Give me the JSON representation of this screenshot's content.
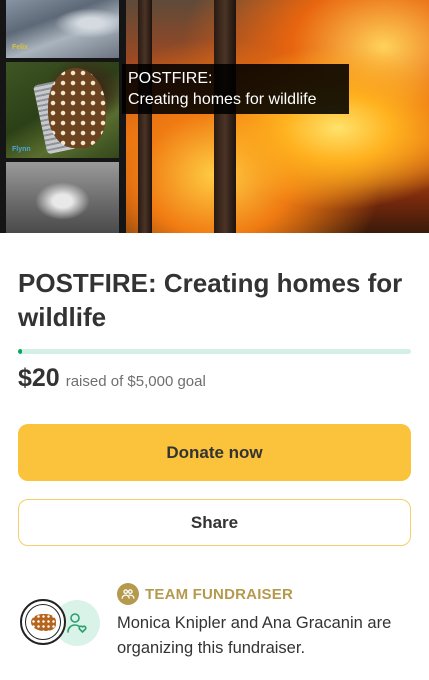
{
  "hero": {
    "thumbnails": [
      {
        "label": "Felix"
      },
      {
        "label": "Flynn"
      },
      {
        "label": ""
      }
    ],
    "caption_line1": "POSTFIRE:",
    "caption_line2": "Creating homes for wildlife"
  },
  "campaign": {
    "title": "POSTFIRE: Creating homes for wildlife",
    "raised_amount": "$20",
    "raised_text": "raised of $5,000 goal",
    "progress_fraction": 0.004,
    "progress_color": "#02a95c",
    "progress_track_color": "#d4f0e6"
  },
  "actions": {
    "donate_label": "Donate now",
    "donate_color": "#fbc33b",
    "share_label": "Share"
  },
  "organizer": {
    "badge_icon": "team-icon",
    "badge_label": "TEAM FUNDRAISER",
    "badge_color": "#b59a4e",
    "description": "Monica Knipler and Ana Gracanin are organizing this fundraiser.",
    "avatars": [
      "logo-avatar",
      "person-icon"
    ]
  }
}
